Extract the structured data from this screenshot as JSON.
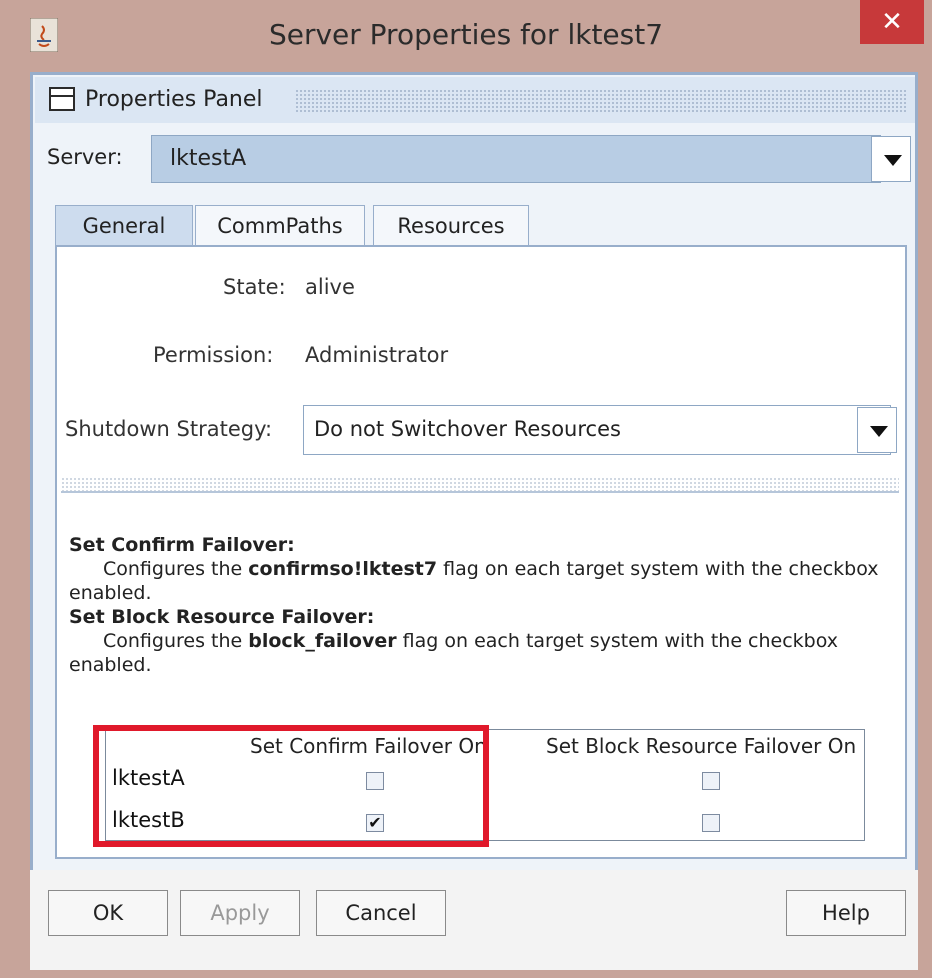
{
  "window": {
    "title": "Server Properties for lktest7",
    "close_glyph": "✕"
  },
  "panel": {
    "title": "Properties Panel"
  },
  "server": {
    "label": "Server:",
    "value": "lktestA"
  },
  "tabs": [
    {
      "label": "General",
      "active": true
    },
    {
      "label": "CommPaths",
      "active": false
    },
    {
      "label": "Resources",
      "active": false
    }
  ],
  "general": {
    "state_label": "State:",
    "state_value": "alive",
    "permission_label": "Permission:",
    "permission_value": "Administrator",
    "shutdown_label": "Shutdown Strategy:",
    "shutdown_value": "Do not Switchover Resources"
  },
  "description": {
    "confirm_heading": "Set Confirm Failover:",
    "confirm_pre": "Configures the ",
    "confirm_flag": "confirmso!lktest7",
    "confirm_post": " flag on each target system with the checkbox enabled.",
    "block_heading": "Set Block Resource Failover:",
    "block_pre": "Configures the ",
    "block_flag": "block_failover",
    "block_post": " flag on each target system with the checkbox enabled."
  },
  "grid": {
    "col_confirm": "Set Confirm Failover On",
    "col_block": "Set Block Resource Failover On",
    "rows": [
      {
        "name": "lktestA",
        "confirm": false,
        "block": false
      },
      {
        "name": "lktestB",
        "confirm": true,
        "block": false
      }
    ],
    "check_glyph": "✔"
  },
  "buttons": {
    "ok": "OK",
    "apply": "Apply",
    "cancel": "Cancel",
    "help": "Help"
  },
  "colors": {
    "highlight": "#e0192b",
    "titlebar": "#c7a49a",
    "close": "#c7393a"
  }
}
